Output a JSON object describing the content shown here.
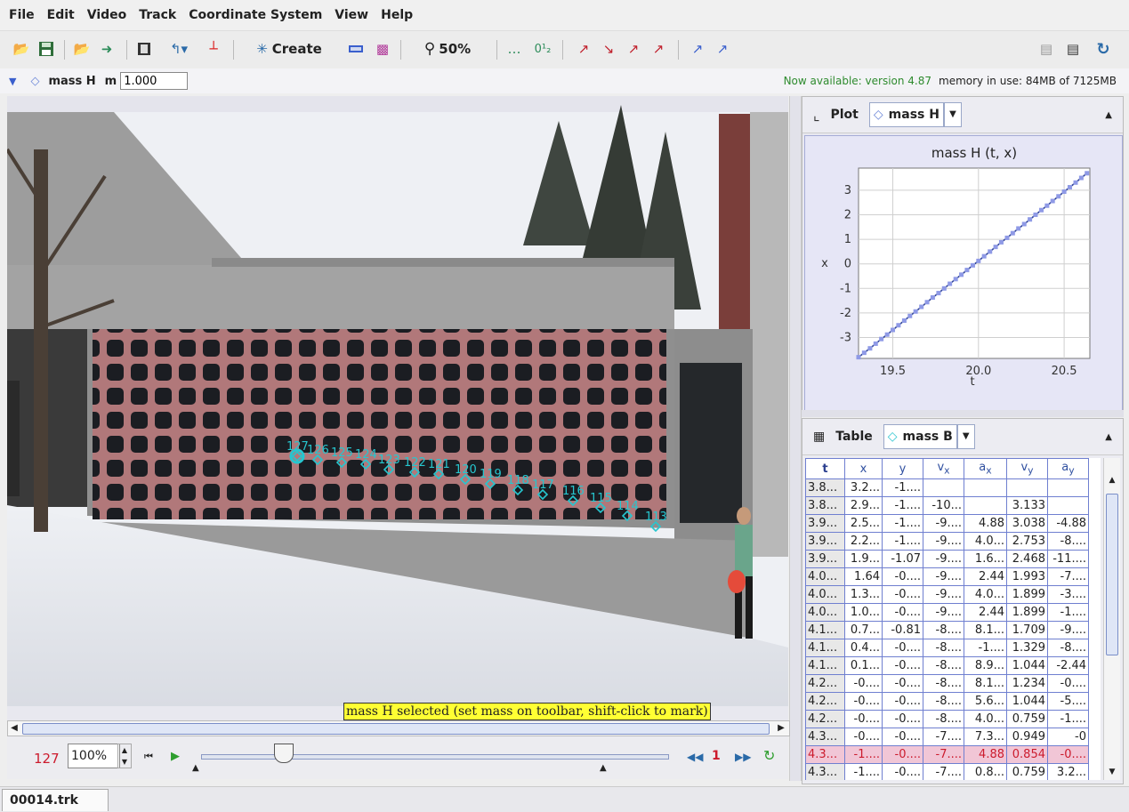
{
  "menu": [
    "File",
    "Edit",
    "Video",
    "Track",
    "Coordinate System",
    "View",
    "Help"
  ],
  "toolbar": {
    "create_label": "Create",
    "zoom_label": "50%"
  },
  "trackbar": {
    "track_name": "mass H",
    "mass_label": "m",
    "mass_value": "1.000",
    "update_notice": "Now available: version 4.87",
    "memory_label": "memory in use: 84MB of 7125MB"
  },
  "video": {
    "marker_labels": [
      "127",
      "126",
      "125",
      "124",
      "123",
      "122",
      "121",
      "120",
      "119",
      "118",
      "117",
      "116",
      "115",
      "114",
      "113"
    ],
    "status_tip": "mass H selected (set mass on toolbar, shift-click to mark)"
  },
  "player": {
    "frame": "127",
    "rate": "100%",
    "step": "1"
  },
  "plot_panel": {
    "title": "Plot",
    "track": "mass H"
  },
  "table_panel": {
    "title": "Table",
    "track": "mass B",
    "columns": [
      "t",
      "x",
      "y",
      "v",
      "a",
      "v",
      "a"
    ],
    "column_subs": [
      "",
      "",
      "",
      "x",
      "x",
      "y",
      "y"
    ],
    "rows": [
      [
        "3.8...",
        "3.2...",
        "-1....",
        "",
        "",
        "",
        ""
      ],
      [
        "3.8...",
        "2.9...",
        "-1....",
        "-10...",
        "",
        "3.133",
        ""
      ],
      [
        "3.9...",
        "2.5...",
        "-1....",
        "-9....",
        "4.88",
        "3.038",
        "-4.88"
      ],
      [
        "3.9...",
        "2.2...",
        "-1....",
        "-9....",
        "4.0...",
        "2.753",
        "-8...."
      ],
      [
        "3.9...",
        "1.9...",
        "-1.07",
        "-9....",
        "1.6...",
        "2.468",
        "-11...."
      ],
      [
        "4.0...",
        "1.64",
        "-0....",
        "-9....",
        "2.44",
        "1.993",
        "-7...."
      ],
      [
        "4.0...",
        "1.3...",
        "-0....",
        "-9....",
        "4.0...",
        "1.899",
        "-3...."
      ],
      [
        "4.0...",
        "1.0...",
        "-0....",
        "-9....",
        "2.44",
        "1.899",
        "-1...."
      ],
      [
        "4.1...",
        "0.7...",
        "-0.81",
        "-8....",
        "8.1...",
        "1.709",
        "-9...."
      ],
      [
        "4.1...",
        "0.4...",
        "-0....",
        "-8....",
        "-1....",
        "1.329",
        "-8...."
      ],
      [
        "4.1...",
        "0.1...",
        "-0....",
        "-8....",
        "8.9...",
        "1.044",
        "-2.44"
      ],
      [
        "4.2...",
        "-0....",
        "-0....",
        "-8....",
        "8.1...",
        "1.234",
        "-0...."
      ],
      [
        "4.2...",
        "-0....",
        "-0....",
        "-8....",
        "5.6...",
        "1.044",
        "-5...."
      ],
      [
        "4.2...",
        "-0....",
        "-0....",
        "-8....",
        "4.0...",
        "0.759",
        "-1...."
      ],
      [
        "4.3...",
        "-0....",
        "-0....",
        "-7....",
        "7.3...",
        "0.949",
        "-0"
      ],
      [
        "4.3...",
        "-1....",
        "-0....",
        "-7....",
        "4.88",
        "0.854",
        "-0...."
      ],
      [
        "4.3...",
        "-1....",
        "-0....",
        "-7....",
        "0.8...",
        "0.759",
        "3.2..."
      ]
    ],
    "highlight_row": 15
  },
  "file_tab": "00014.trk",
  "colors": {
    "accent": "#3a5fcd",
    "marker": "#26c6cf",
    "notice": "#2e8b2e",
    "highlight": "#f1c6d6",
    "frame_red": "#cc1b2d"
  },
  "chart_data": {
    "type": "scatter",
    "title": "mass H (t, x)",
    "xlabel": "t",
    "ylabel": "x",
    "xlim": [
      19.3,
      20.65
    ],
    "ylim": [
      -3.85,
      3.9
    ],
    "xticks": [
      19.5,
      20.0,
      20.5
    ],
    "yticks": [
      3,
      2,
      1,
      0,
      -1,
      -2,
      -3
    ],
    "xtick_labels": [
      "19.5",
      "20.0",
      "20.5"
    ],
    "ytick_labels": [
      "3",
      "2",
      "1",
      "0",
      "-1",
      "-2",
      "-3"
    ],
    "grid": true,
    "series": [
      {
        "x": [
          19.3,
          19.333,
          19.367,
          19.4,
          19.433,
          19.467,
          19.5,
          19.533,
          19.567,
          19.6,
          19.633,
          19.667,
          19.7,
          19.733,
          19.767,
          19.8,
          19.833,
          19.867,
          19.9,
          19.933,
          19.967,
          20.0,
          20.033,
          20.067,
          20.1,
          20.133,
          20.167,
          20.2,
          20.233,
          20.267,
          20.3,
          20.333,
          20.367,
          20.4,
          20.433,
          20.467,
          20.5,
          20.533,
          20.567,
          20.6,
          20.633
        ],
        "y": [
          -3.8,
          -3.62,
          -3.44,
          -3.25,
          -3.06,
          -2.88,
          -2.69,
          -2.5,
          -2.31,
          -2.12,
          -1.94,
          -1.75,
          -1.56,
          -1.37,
          -1.19,
          -1.0,
          -0.81,
          -0.62,
          -0.44,
          -0.25,
          -0.06,
          0.12,
          0.31,
          0.5,
          0.69,
          0.88,
          1.06,
          1.25,
          1.44,
          1.62,
          1.81,
          2.0,
          2.19,
          2.37,
          2.56,
          2.75,
          2.94,
          3.12,
          3.31,
          3.5,
          3.69
        ]
      }
    ]
  }
}
